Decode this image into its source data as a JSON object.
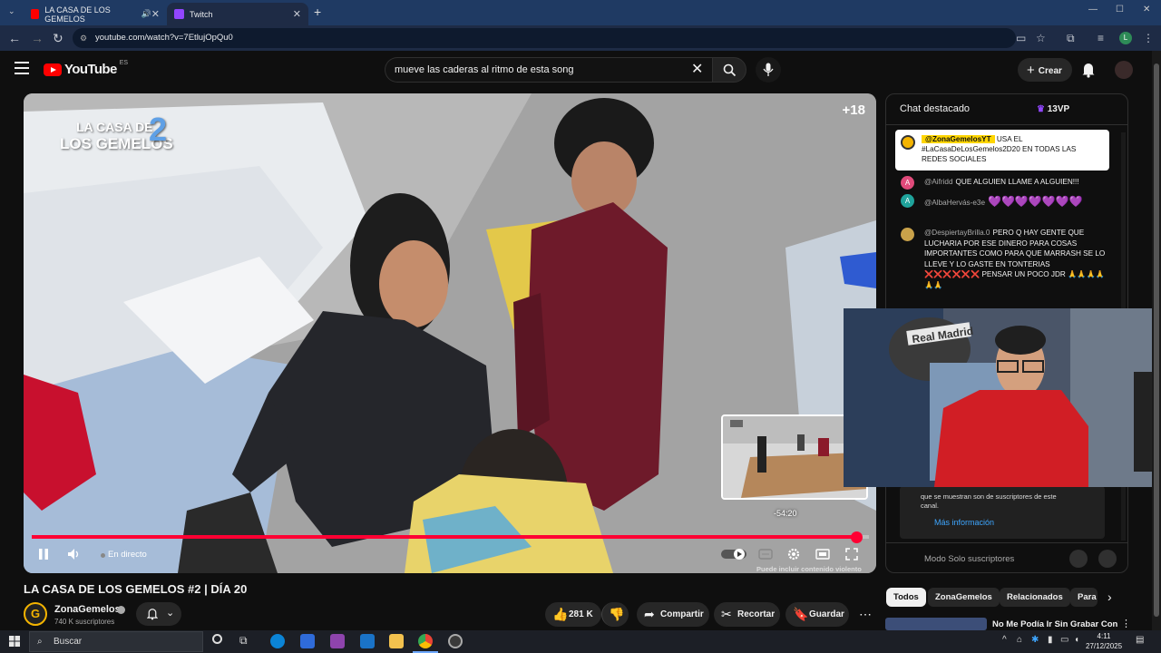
{
  "browser": {
    "tabs": [
      {
        "title": "LA CASA DE LOS GEMELOS",
        "active": false
      },
      {
        "title": "Twitch",
        "active": true
      }
    ],
    "url": "youtube.com/watch?v=7EtlujOpQu0",
    "profile_initial": "L"
  },
  "masthead": {
    "logo_text": "YouTube",
    "region": "ES",
    "search_query": "mueve las caderas al ritmo de esta song",
    "create_label": "Crear"
  },
  "player": {
    "watermark_line1": "LA CASA DE",
    "watermark_line2": "LOS GEMELOS",
    "watermark_num": "2",
    "age_rating": "+18",
    "preview_time": "-54:20",
    "live_label": "En directo",
    "content_warning": "Puede incluir contenido violento",
    "progress": 0.985
  },
  "chat": {
    "title": "Chat destacado",
    "viewers": "13VP",
    "pinned_author": "@ZonaGemelosYT",
    "pinned_text": "USA EL #LaCasaDeLosGemelos2D20 EN TODAS LAS REDES SOCIALES",
    "messages": [
      {
        "initial": "A",
        "color": "#e04a7a",
        "author": "@Aifridd",
        "text": "QUE ALGUIEN LLAME A ALGUIEN!!!"
      },
      {
        "initial": "A",
        "color": "#1fa39b",
        "author": "@AlbaHervás-e3e",
        "text": "💜💜💜💜💜💜💜"
      },
      {
        "initial": "",
        "color": "#c9a24a",
        "author": "@DespiertayBrilla.0",
        "text": "PERO Q HAY GENTE QUE LUCHARIA POR ESE DINERO PARA COSAS IMPORTANTES COMO PARA QUE MARRASH SE LO LLEVE Y LO GASTE EN TONTERIAS ❌❌❌❌❌❌ PENSAR UN POCO JDR 🙏🙏🙏🙏🙏🙏"
      }
    ],
    "info_line1": "que se muestran son de suscriptores de este",
    "info_line2": "canal.",
    "more_info": "Más información",
    "footer_mode": "Modo Solo suscriptores"
  },
  "video": {
    "title": "LA CASA DE LOS GEMELOS #2 | DÍA 20",
    "channel": "ZonaGemelos",
    "channel_initial": "G",
    "subscribers": "740 K suscriptores",
    "likes": "281 K",
    "share": "Compartir",
    "clip": "Recortar",
    "save": "Guardar"
  },
  "related": {
    "chips": [
      "Todos",
      "ZonaGemelos",
      "Relacionados",
      "Para"
    ],
    "first_title": "No Me Podía Ir Sin Grabar Con"
  },
  "taskbar": {
    "search_placeholder": "Buscar",
    "time": "4:11",
    "date": "27/12/2025"
  },
  "colors": {
    "accent_red": "#ff0033",
    "link_blue": "#3ea6ff",
    "pinned_tag": "#ffd600"
  }
}
